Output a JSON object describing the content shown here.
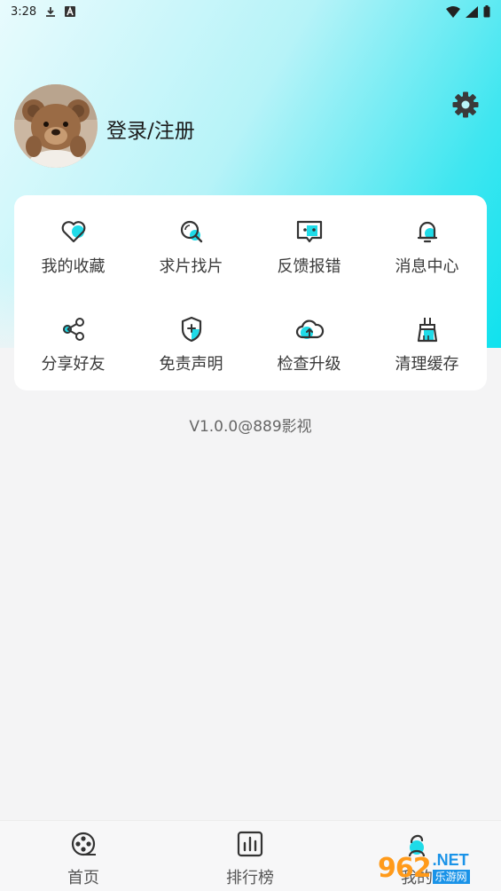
{
  "status_bar": {
    "time": "3:28"
  },
  "profile": {
    "login_label": "登录/注册"
  },
  "menu": {
    "items": [
      {
        "label": "我的收藏",
        "icon": "heart-icon"
      },
      {
        "label": "求片找片",
        "icon": "search-film-icon"
      },
      {
        "label": "反馈报错",
        "icon": "feedback-icon"
      },
      {
        "label": "消息中心",
        "icon": "bell-icon"
      },
      {
        "label": "分享好友",
        "icon": "share-icon"
      },
      {
        "label": "免责声明",
        "icon": "shield-plus-icon"
      },
      {
        "label": "检查升级",
        "icon": "cloud-upload-icon"
      },
      {
        "label": "清理缓存",
        "icon": "broom-icon"
      }
    ]
  },
  "version": "V1.0.0@889影视",
  "bottom_nav": {
    "items": [
      {
        "label": "首页",
        "icon": "film-reel-icon"
      },
      {
        "label": "排行榜",
        "icon": "bar-chart-icon"
      },
      {
        "label": "我的",
        "icon": "person-icon"
      }
    ]
  },
  "watermark": {
    "number": "962",
    "domain": ".NET",
    "text": "乐游网"
  },
  "colors": {
    "accent": "#1fdbe8",
    "icon_stroke": "#333333"
  }
}
